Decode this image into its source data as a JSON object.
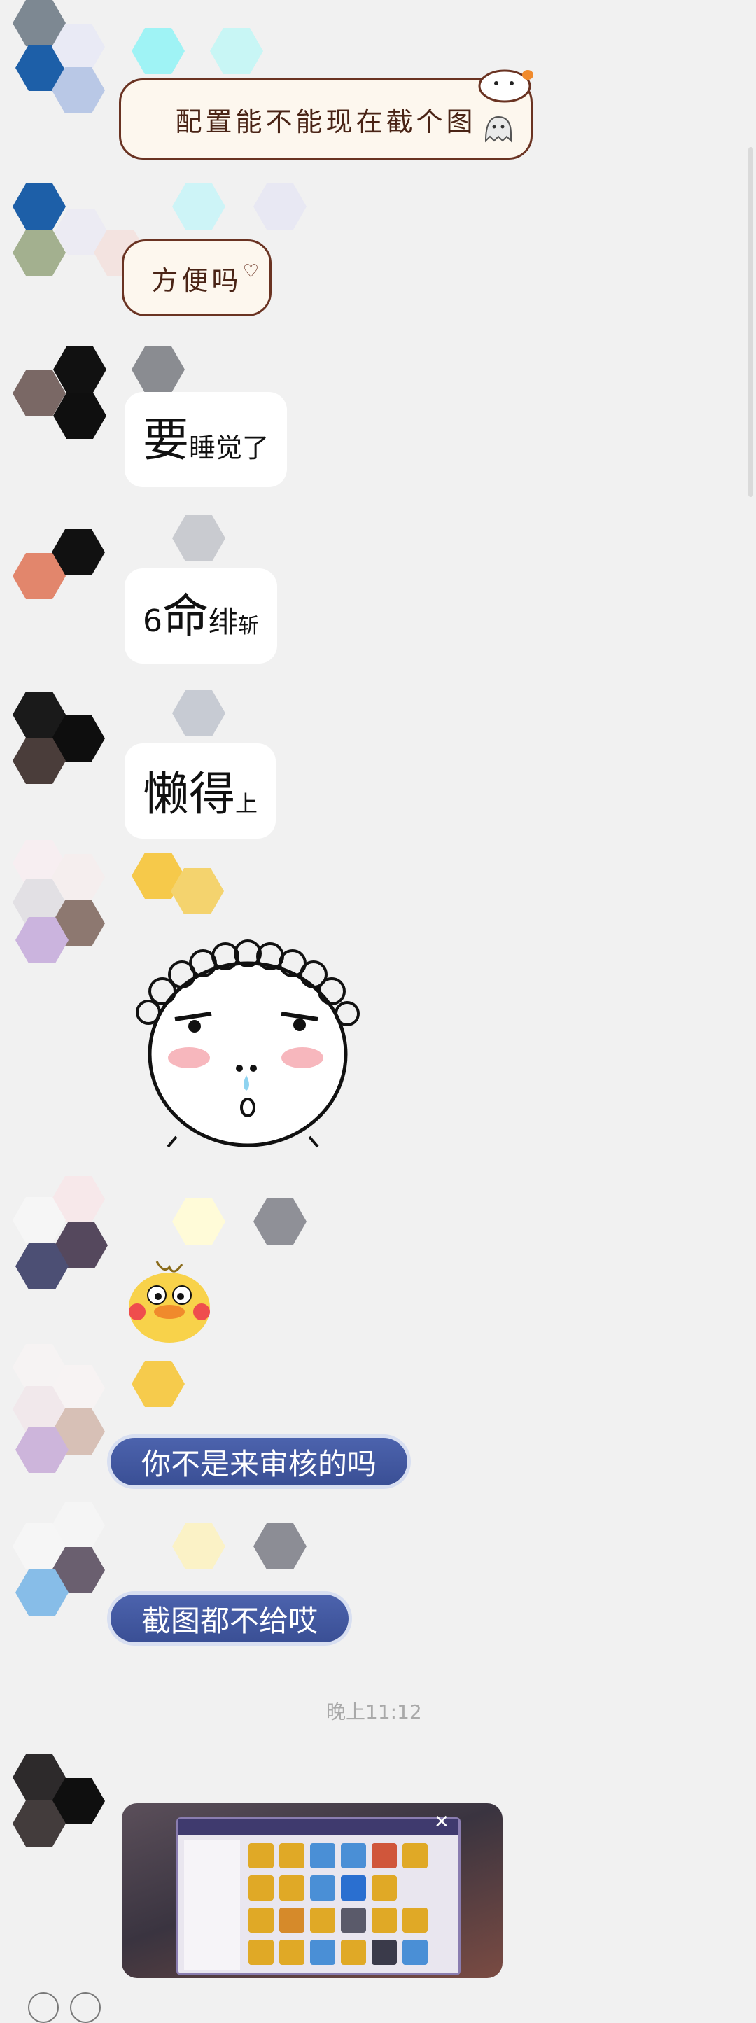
{
  "messages": [
    {
      "type": "sticker_text",
      "text": "配置能不能现在截个图"
    },
    {
      "type": "sticker_text",
      "text": "方便吗"
    },
    {
      "type": "text",
      "parts": [
        "要",
        "睡觉了"
      ]
    },
    {
      "type": "text",
      "parts": [
        "6",
        "命",
        "绯",
        "斩"
      ]
    },
    {
      "type": "text",
      "parts": [
        "懒得",
        "上"
      ]
    },
    {
      "type": "sticker",
      "icon": "curly-hair-face-sticker"
    },
    {
      "type": "sticker",
      "icon": "yellow-duck-sticker"
    },
    {
      "type": "blue_bubble",
      "text": "你不是来审核的吗"
    },
    {
      "type": "blue_bubble",
      "text": "截图都不给哎"
    },
    {
      "type": "image",
      "icon": "game-screenshot-thumbnail"
    }
  ],
  "timestamp": "晚上11:12",
  "colors": {
    "background": "#f1f1f1",
    "blue_bubble": "#3f55a0",
    "cute_border": "#6a3322"
  }
}
